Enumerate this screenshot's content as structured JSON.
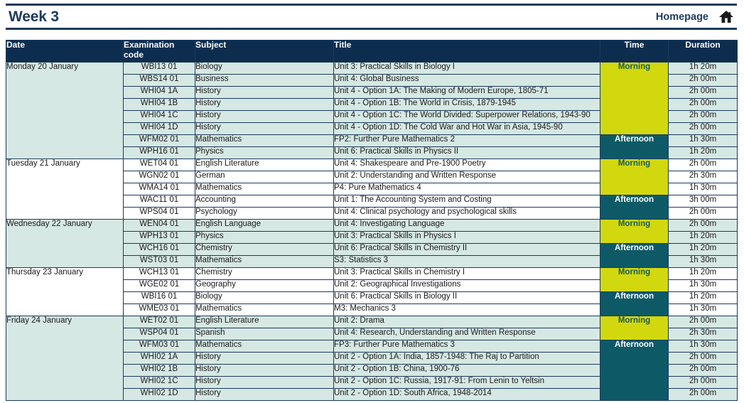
{
  "header": {
    "title": "Week 3",
    "homepage_label": "Homepage",
    "home_icon": "house-icon"
  },
  "colors": {
    "header_navy": "#0d2d4f",
    "rule_navy": "#1c3a5e",
    "morning_bg": "#d2d80e",
    "morning_text": "#1a5c52",
    "afternoon_bg": "#0d5a66",
    "afternoon_text": "#ffffff",
    "row_shade": "#d6e8e3",
    "row_plain": "#ffffff"
  },
  "table": {
    "columns": [
      "Date",
      "Examination code",
      "Subject",
      "Title",
      "Time",
      "Duration"
    ],
    "days": [
      {
        "date": "Monday 20 January",
        "shade": "shade",
        "sessions": [
          {
            "time": "Morning",
            "exams": [
              {
                "code": "WBI13 01",
                "subject": "Biology",
                "title": "Unit 3: Practical Skills in Biology I",
                "duration": "1h 20m"
              },
              {
                "code": "WBS14 01",
                "subject": "Business",
                "title": "Unit 4: Global Business",
                "duration": "2h 00m"
              },
              {
                "code": "WHI04 1A",
                "subject": "History",
                "title": "Unit 4 - Option 1A: The Making of Modern Europe, 1805-71",
                "duration": "2h 00m"
              },
              {
                "code": "WHI04 1B",
                "subject": "History",
                "title": "Unit 4 - Option 1B: The World in Crisis, 1879-1945",
                "duration": "2h 00m"
              },
              {
                "code": "WHI04 1C",
                "subject": "History",
                "title": "Unit 4 - Option 1C: The World Divided: Superpower Relations, 1943-90",
                "duration": "2h 00m"
              },
              {
                "code": "WHI04 1D",
                "subject": "History",
                "title": "Unit 4 - Option 1D: The Cold War and Hot War in Asia, 1945-90",
                "duration": "2h 00m"
              }
            ]
          },
          {
            "time": "Afternoon",
            "exams": [
              {
                "code": "WFM02 01",
                "subject": "Mathematics",
                "title": "FP2: Further Pure Mathematics 2",
                "duration": "1h 30m"
              },
              {
                "code": "WPH16 01",
                "subject": "Physics",
                "title": "Unit 6: Practical Skills in Physics II",
                "duration": "1h 20m"
              }
            ]
          }
        ]
      },
      {
        "date": "Tuesday 21 January",
        "shade": "plain",
        "sessions": [
          {
            "time": "Morning",
            "exams": [
              {
                "code": "WET04 01",
                "subject": "English Literature",
                "title": "Unit 4: Shakespeare and Pre-1900 Poetry",
                "duration": "2h 00m"
              },
              {
                "code": "WGN02 01",
                "subject": "German",
                "title": "Unit 2: Understanding and Written Response",
                "duration": "2h 30m"
              },
              {
                "code": "WMA14 01",
                "subject": "Mathematics",
                "title": "P4: Pure Mathematics 4",
                "duration": "1h 30m"
              }
            ]
          },
          {
            "time": "Afternoon",
            "exams": [
              {
                "code": "WAC11 01",
                "subject": "Accounting",
                "title": "Unit 1: The Accounting System and Costing",
                "duration": "3h 00m"
              },
              {
                "code": "WPS04 01",
                "subject": "Psychology",
                "title": "Unit 4: Clinical psychology and psychological skills",
                "duration": "2h 00m"
              }
            ]
          }
        ]
      },
      {
        "date": "Wednesday 22 January",
        "shade": "shade",
        "sessions": [
          {
            "time": "Morning",
            "exams": [
              {
                "code": "WEN04 01",
                "subject": "English Language",
                "title": "Unit 4: Investigating Language",
                "duration": "2h 00m"
              },
              {
                "code": "WPH13 01",
                "subject": "Physics",
                "title": "Unit 3: Practical Skills in Physics I",
                "duration": "1h 20m"
              }
            ]
          },
          {
            "time": "Afternoon",
            "exams": [
              {
                "code": "WCH16 01",
                "subject": "Chemistry",
                "title": "Unit 6: Practical Skills in Chemistry II",
                "duration": "1h 20m"
              },
              {
                "code": "WST03 01",
                "subject": "Mathematics",
                "title": "S3: Statistics 3",
                "duration": "1h 30m"
              }
            ]
          }
        ]
      },
      {
        "date": "Thursday 23 January",
        "shade": "plain",
        "sessions": [
          {
            "time": "Morning",
            "exams": [
              {
                "code": "WCH13 01",
                "subject": "Chemistry",
                "title": "Unit 3: Practical Skills in Chemistry I",
                "duration": "1h 20m"
              },
              {
                "code": "WGE02 01",
                "subject": "Geography",
                "title": "Unit 2: Geographical Investigations",
                "duration": "1h 30m"
              }
            ]
          },
          {
            "time": "Afternoon",
            "exams": [
              {
                "code": "WBI16 01",
                "subject": "Biology",
                "title": "Unit 6: Practical Skills in Biology II",
                "duration": "1h 20m"
              },
              {
                "code": "WME03 01",
                "subject": "Mathematics",
                "title": "M3: Mechanics 3",
                "duration": "1h 30m"
              }
            ]
          }
        ]
      },
      {
        "date": "Friday 24 January",
        "shade": "shade",
        "sessions": [
          {
            "time": "Morning",
            "exams": [
              {
                "code": "WET02 01",
                "subject": "English Literature",
                "title": "Unit 2: Drama",
                "duration": "2h 00m"
              },
              {
                "code": "WSP04 01",
                "subject": "Spanish",
                "title": "Unit 4: Research, Understanding and Written Response",
                "duration": "2h 30m"
              }
            ]
          },
          {
            "time": "Afternoon",
            "exams": [
              {
                "code": "WFM03 01",
                "subject": "Mathematics",
                "title": "FP3: Further Pure Mathematics 3",
                "duration": "1h 30m"
              },
              {
                "code": "WHI02 1A",
                "subject": "History",
                "title": "Unit 2 - Option 1A: India, 1857-1948: The Raj to Partition",
                "duration": "2h 00m"
              },
              {
                "code": "WHI02 1B",
                "subject": "History",
                "title": "Unit 2 - Option 1B: China, 1900-76",
                "duration": "2h 00m"
              },
              {
                "code": "WHI02 1C",
                "subject": "History",
                "title": "Unit 2 - Option 1C: Russia, 1917-91: From Lenin to Yeltsin",
                "duration": "2h 00m"
              },
              {
                "code": "WHI02 1D",
                "subject": "History",
                "title": "Unit 2 - Option 1D: South Africa, 1948-2014",
                "duration": "2h 00m"
              }
            ]
          }
        ]
      }
    ]
  }
}
